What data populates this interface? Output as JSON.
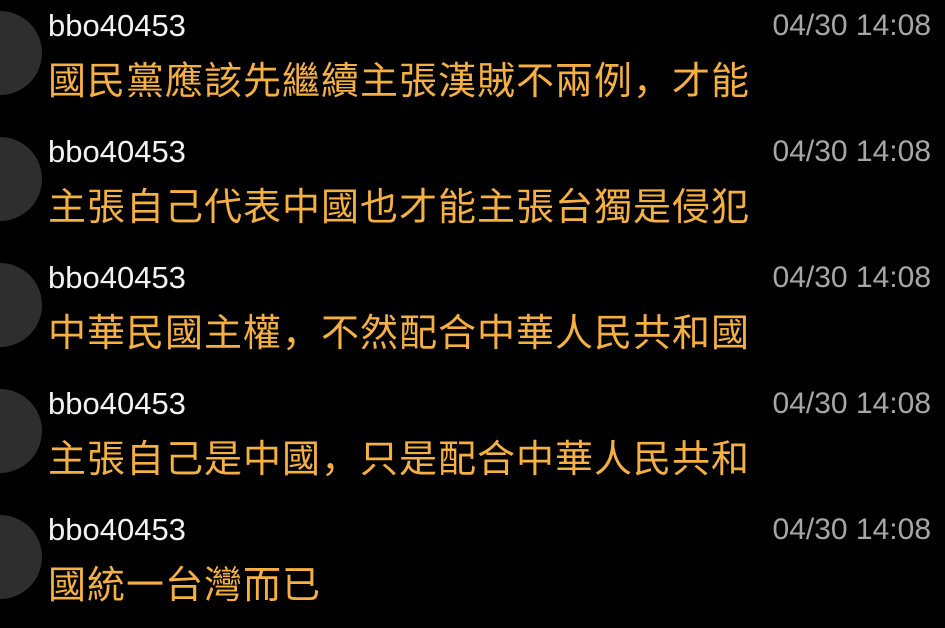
{
  "comments": [
    {
      "username": "bbo40453",
      "timestamp": "04/30 14:08",
      "text": "國民黨應該先繼續主張漢賊不兩例，才能"
    },
    {
      "username": "bbo40453",
      "timestamp": "04/30 14:08",
      "text": "主張自己代表中國也才能主張台獨是侵犯"
    },
    {
      "username": "bbo40453",
      "timestamp": "04/30 14:08",
      "text": "中華民國主權，不然配合中華人民共和國"
    },
    {
      "username": "bbo40453",
      "timestamp": "04/30 14:08",
      "text": "主張自己是中國，只是配合中華人民共和"
    },
    {
      "username": "bbo40453",
      "timestamp": "04/30 14:08",
      "text": "國統一台灣而已"
    }
  ],
  "colors": {
    "background": "#000000",
    "username": "#f2f2f2",
    "timestamp": "#a6a6a6",
    "comment_text": "#f5b041",
    "avatar": "#2e2e2e"
  }
}
